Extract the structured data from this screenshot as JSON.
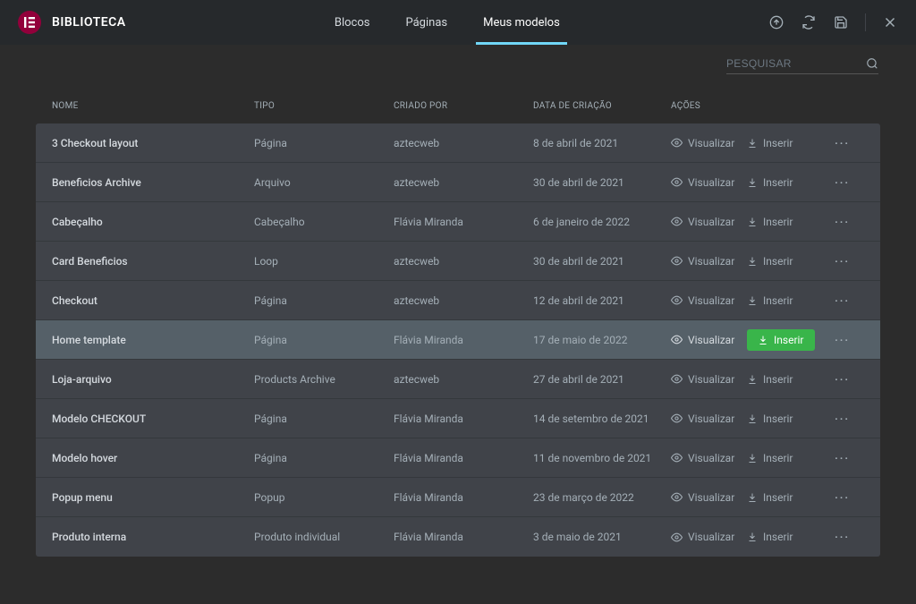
{
  "header": {
    "brand": "BIBLIOTECA",
    "tabs": [
      "Blocos",
      "Páginas",
      "Meus modelos"
    ],
    "active_tab": 2
  },
  "search": {
    "placeholder": "PESQUISAR"
  },
  "table": {
    "columns": [
      "NOME",
      "TIPO",
      "CRIADO POR",
      "DATA DE CRIAÇÃO",
      "AÇÕES"
    ],
    "action_labels": {
      "preview": "Visualizar",
      "insert": "Inserir"
    },
    "rows": [
      {
        "name": "3 Checkout layout",
        "type": "Página",
        "by": "aztecweb",
        "date": "8 de abril de 2021",
        "hover": false
      },
      {
        "name": "Beneficios Archive",
        "type": "Arquivo",
        "by": "aztecweb",
        "date": "30 de abril de 2021",
        "hover": false
      },
      {
        "name": "Cabeçalho",
        "type": "Cabeçalho",
        "by": "Flávia Miranda",
        "date": "6 de janeiro de 2022",
        "hover": false
      },
      {
        "name": "Card Beneficios",
        "type": "Loop",
        "by": "aztecweb",
        "date": "30 de abril de 2021",
        "hover": false
      },
      {
        "name": "Checkout",
        "type": "Página",
        "by": "aztecweb",
        "date": "12 de abril de 2021",
        "hover": false
      },
      {
        "name": "Home template",
        "type": "Página",
        "by": "Flávia Miranda",
        "date": "17 de maio de 2022",
        "hover": true
      },
      {
        "name": "Loja-arquivo",
        "type": "Products Archive",
        "by": "aztecweb",
        "date": "27 de abril de 2021",
        "hover": false
      },
      {
        "name": "Modelo CHECKOUT",
        "type": "Página",
        "by": "Flávia Miranda",
        "date": "14 de setembro de 2021",
        "hover": false
      },
      {
        "name": "Modelo hover",
        "type": "Página",
        "by": "Flávia Miranda",
        "date": "11 de novembro de 2021",
        "hover": false
      },
      {
        "name": "Popup menu",
        "type": "Popup",
        "by": "Flávia Miranda",
        "date": "23 de março de 2022",
        "hover": false
      },
      {
        "name": "Produto interna",
        "type": "Produto individual",
        "by": "Flávia Miranda",
        "date": "3 de maio de 2021",
        "hover": false
      }
    ]
  }
}
